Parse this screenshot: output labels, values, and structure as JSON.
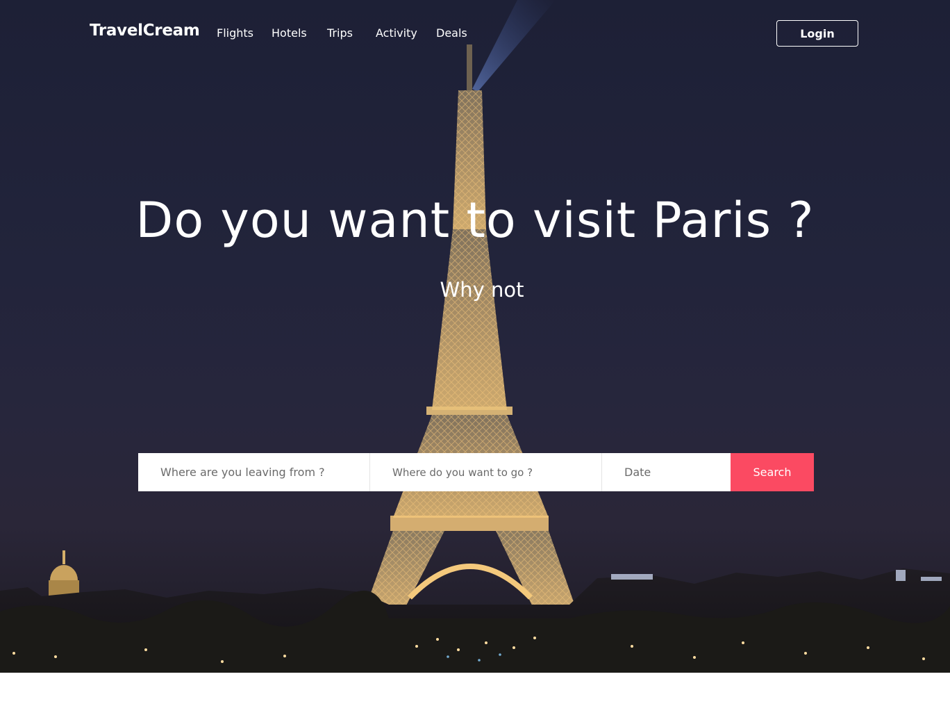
{
  "brand": "TravelCream",
  "nav": {
    "links": [
      "Flights",
      "Hotels",
      "Trips",
      "Activity",
      "Deals"
    ],
    "login_label": "Login"
  },
  "hero": {
    "headline": "Do you want to visit Paris ?",
    "subheadline": "Why not",
    "background_image": "eiffel-tower-night-photo"
  },
  "search": {
    "from_placeholder": "Where are you leaving from ?",
    "to_placeholder": "Where do you want to go ?",
    "date_placeholder": "Date",
    "button_label": "Search"
  },
  "colors": {
    "accent": "#fb4a62",
    "hero_dark": "#22243b",
    "text_light": "#ffffff"
  }
}
